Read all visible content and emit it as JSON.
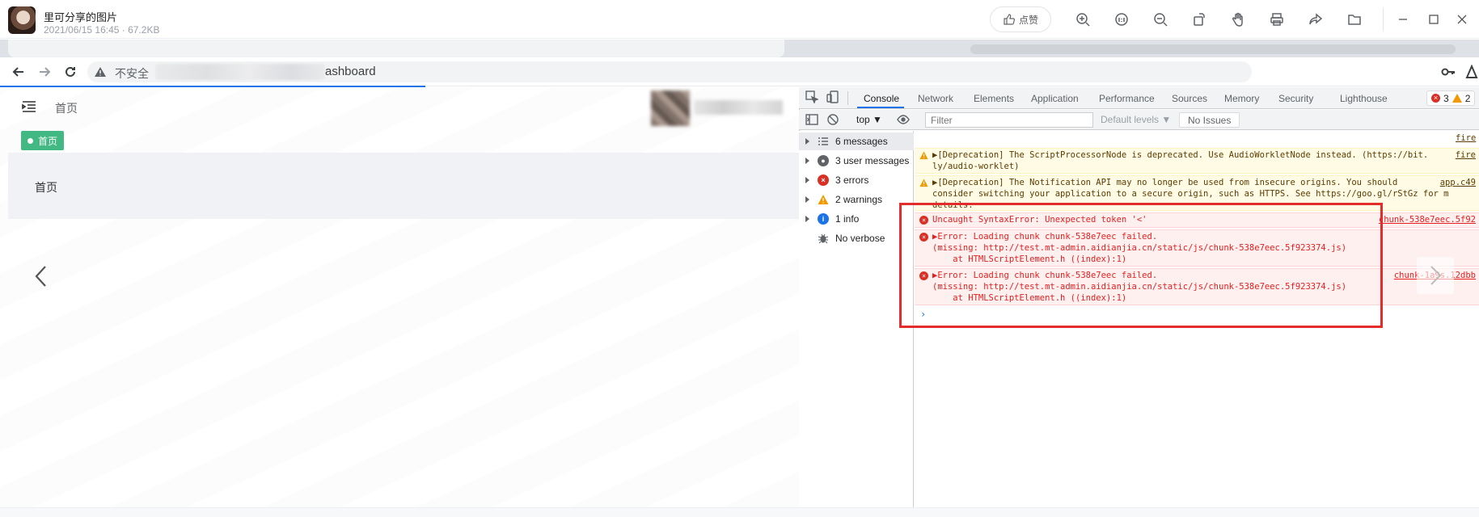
{
  "viewer": {
    "file_title": "里可分享的图片",
    "file_meta": "2021/06/15 16:45 · 67.2KB",
    "like_label": "点赞",
    "tools": [
      "zoom-in-icon",
      "actual-size-icon",
      "zoom-out-icon",
      "rotate-icon",
      "hand-icon",
      "print-icon",
      "share-icon",
      "folder-icon"
    ]
  },
  "browser": {
    "insecure_label": "不安全",
    "url_suffix": "ashboard"
  },
  "page": {
    "breadcrumb": "首页",
    "tag_label": "首页",
    "heading": "首页"
  },
  "devtools": {
    "tabs": [
      "Console",
      "Network",
      "Elements",
      "Application",
      "Performance",
      "Sources",
      "Memory",
      "Security",
      "Lighthouse"
    ],
    "active_tab": "Console",
    "error_count": "3",
    "warning_count": "2",
    "context": "top",
    "filter_placeholder": "Filter",
    "levels_label": "Default levels",
    "no_issues_label": "No Issues",
    "sidebar": [
      {
        "label": "6 messages",
        "icon": "list-icon"
      },
      {
        "label": "3 user messages",
        "icon": "user-icon"
      },
      {
        "label": "3 errors",
        "icon": "error-icon"
      },
      {
        "label": "2 warnings",
        "icon": "warning-icon"
      },
      {
        "label": "1 info",
        "icon": "info-icon"
      },
      {
        "label": "No verbose",
        "icon": "bug-icon"
      }
    ],
    "top_source": "fire",
    "logs": [
      {
        "level": "warning",
        "lines": [
          "▶[Deprecation] The ScriptProcessorNode is deprecated. Use AudioWorkletNode instead. (https://bit.",
          "ly/audio-worklet)"
        ],
        "source": "fire"
      },
      {
        "level": "warning",
        "lines": [
          "▶[Deprecation] The Notification API may no longer be used from insecure origins. You should",
          "consider switching your application to a secure origin, such as HTTPS. See https://goo.gl/rStGz for m",
          "details."
        ],
        "source": "app.c49"
      },
      {
        "level": "error",
        "lines": [
          "Uncaught SyntaxError: Unexpected token '<'"
        ],
        "source": "chunk-538e7eec.5f92"
      },
      {
        "level": "error",
        "lines": [
          "▶Error: Loading chunk chunk-538e7eec failed.",
          "(missing: http://test.mt-admin.aidianjia.cn/static/js/chunk-538e7eec.5f923374.js)",
          "    at HTMLScriptElement.h ((index):1)"
        ],
        "source": ""
      },
      {
        "level": "error",
        "lines": [
          "▶Error: Loading chunk chunk-538e7eec failed.",
          "(missing: http://test.mt-admin.aidianjia.cn/static/js/chunk-538e7eec.5f923374.js)",
          "    at HTMLScriptElement.h ((index):1)"
        ],
        "source": "chunk-1a9s.12dbb"
      }
    ],
    "prompt": "›"
  },
  "colors": {
    "accent": "#1a73e8",
    "tag_green": "#42b983",
    "error": "#e61e1e",
    "highlight": "#e32d2d"
  }
}
